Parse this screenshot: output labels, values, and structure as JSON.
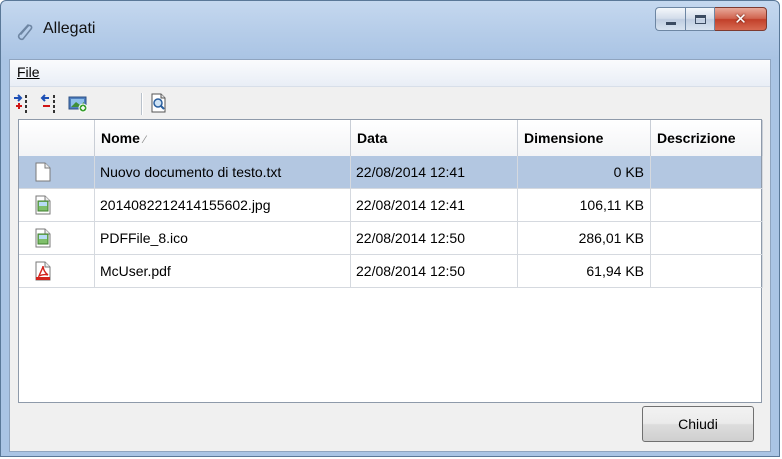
{
  "window": {
    "title": "Allegati"
  },
  "menu": {
    "file_label": "File"
  },
  "toolbar": {
    "buttons": [
      "add-attachment-icon",
      "remove-attachment-icon",
      "add-image-icon",
      "preview-icon"
    ]
  },
  "table": {
    "columns": [
      "Nome",
      "Data",
      "Dimensione",
      "Descrizione"
    ],
    "sort_indicator": "⁄",
    "rows": [
      {
        "icon": "text-file-icon",
        "name": "Nuovo documento di testo.txt",
        "date": "22/08/2014 12:41",
        "size": "0 KB",
        "description": "",
        "selected": true
      },
      {
        "icon": "image-file-icon",
        "name": "2014082212414155602.jpg",
        "date": "22/08/2014 12:41",
        "size": "106,11 KB",
        "description": "",
        "selected": false
      },
      {
        "icon": "image-file-icon",
        "name": "PDFFile_8.ico",
        "date": "22/08/2014 12:50",
        "size": "286,01 KB",
        "description": "",
        "selected": false
      },
      {
        "icon": "pdf-file-icon",
        "name": "McUser.pdf",
        "date": "22/08/2014 12:50",
        "size": "61,94 KB",
        "description": "",
        "selected": false
      }
    ]
  },
  "footer": {
    "close_label": "Chiudi"
  },
  "colors": {
    "selection": "#b3c7e1",
    "title_bar": "#b6cde9",
    "pdf_red": "#d2231c"
  }
}
